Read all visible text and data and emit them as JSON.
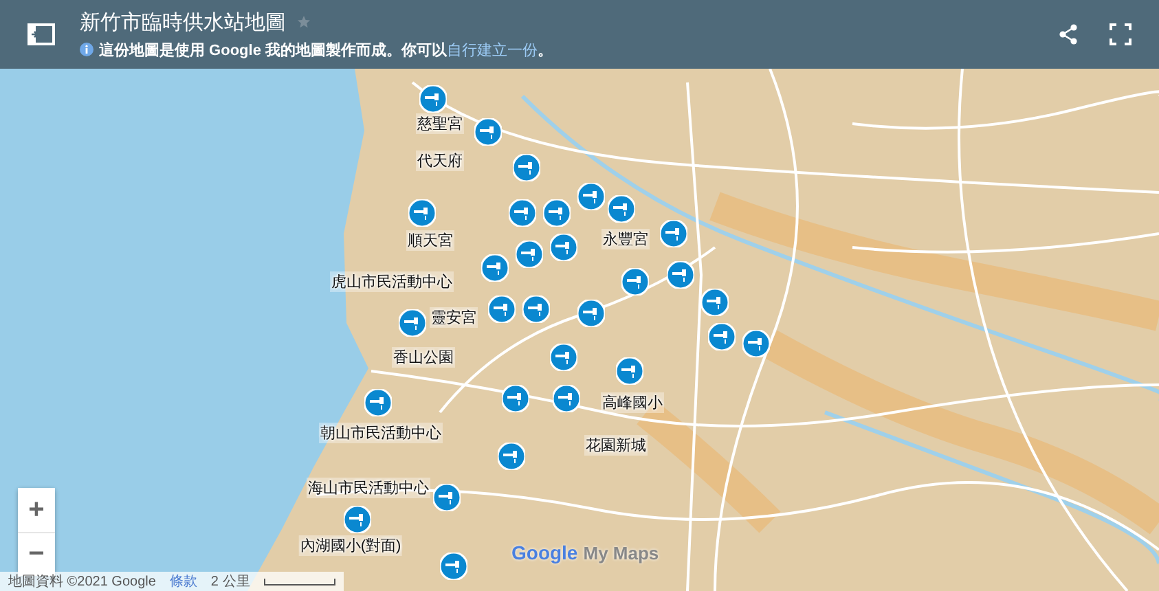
{
  "header": {
    "title": "新竹市臨時供水站地圖",
    "notice": "這份地圖是使用 Google 我的地圖製作而成。你可以",
    "notice_link": "自行建立一份",
    "notice_end": "。"
  },
  "map": {
    "labels": [
      "慈聖宮",
      "代天府",
      "順天宮",
      "虎山市民活動中心",
      "靈安宮",
      "永豐宮",
      "香山公園",
      "高峰國小",
      "花園新城",
      "朝山市民活動中心",
      "海山市民活動中心",
      "內湖國小(對面)"
    ],
    "zoom_controls": [
      "+",
      "−"
    ],
    "logo": {
      "brand": "Google",
      "product": "My Maps"
    },
    "attribution": "地圖資料 ©2021 Google",
    "terms_link": "條款",
    "scale": "2 公里"
  }
}
